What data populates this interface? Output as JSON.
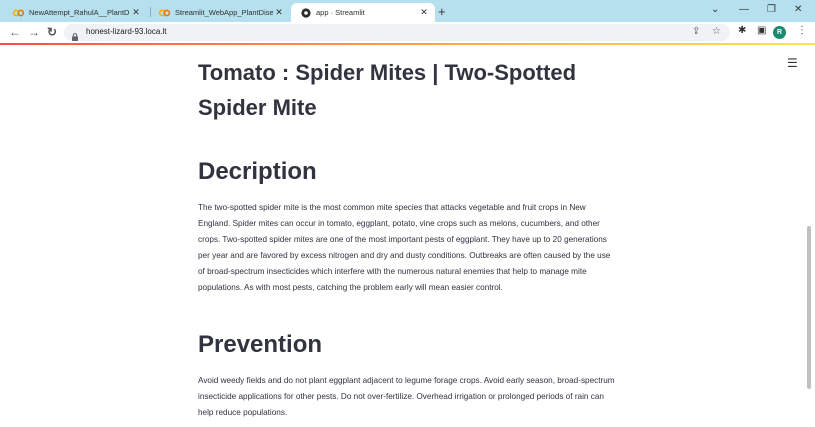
{
  "browser": {
    "tabs": [
      {
        "title": "NewAttempt_RahulA__PlantDisea",
        "icon": "colab-icon"
      },
      {
        "title": "Streamlit_WebApp_PlantDisease",
        "icon": "colab-icon"
      },
      {
        "title": "app · Streamlit",
        "icon": "streamlit-icon"
      }
    ],
    "new_tab": "+",
    "url": "honest-lizard-93.loca.lt",
    "profile_initial": "R",
    "accent": "#ff4b4b"
  },
  "page": {
    "title": "Tomato : Spider Mites | Two-Spotted Spider Mite",
    "description_heading": "Decription",
    "description_text": "The two-spotted spider mite is the most common mite species that attacks vegetable and fruit crops in New England. Spider mites can occur in tomato, eggplant, potato, vine crops such as melons, cucumbers, and other crops. Two-spotted spider mites are one of the most important pests of eggplant. They have up to 20 generations per year and are favored by excess nitrogen and dry and dusty conditions. Outbreaks are often caused by the use of broad-spectrum insecticides which interfere with the numerous natural enemies that help to manage mite populations. As with most pests, catching the problem early will mean easier control.",
    "prevention_heading": "Prevention",
    "prevention_text": "Avoid weedy fields and do not plant eggplant adjacent to legume forage crops. Avoid early season, broad-spectrum insecticide applications for other pests. Do not over-fertilize. Overhead irrigation or prolonged periods of rain can help reduce populations."
  }
}
